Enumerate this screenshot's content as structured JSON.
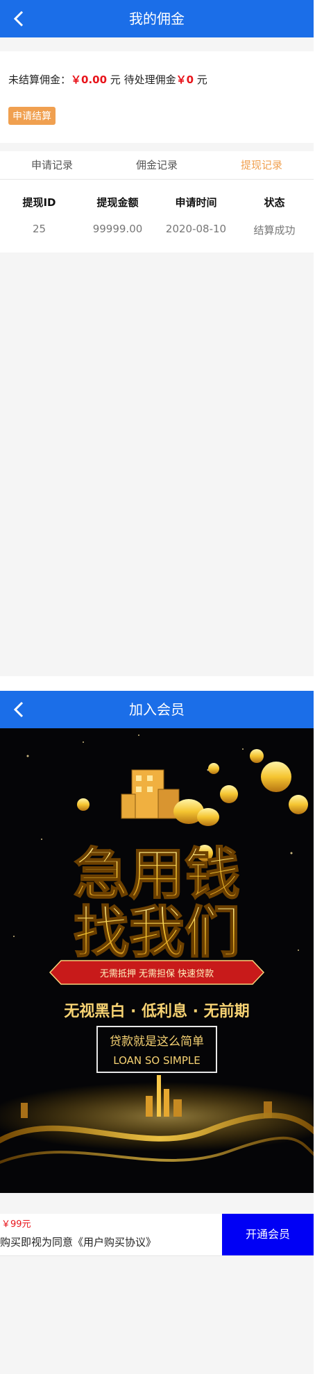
{
  "screen1": {
    "header": {
      "title": "我的佣金"
    },
    "summary": {
      "unsettled_label": "未结算佣金：",
      "unsettled_value": "￥0.00",
      "unit1": " 元 ",
      "pending_label": "待处理佣金",
      "pending_value": "￥0",
      "unit2": " 元"
    },
    "apply_button": "申请结算",
    "tabs": [
      "申请记录",
      "佣金记录",
      "提现记录"
    ],
    "active_tab": 2,
    "table": {
      "headers": [
        "提现ID",
        "提现金额",
        "申请时间",
        "状态"
      ],
      "rows": [
        [
          "25",
          "99999.00",
          "2020-08-10",
          "结算成功"
        ]
      ]
    }
  },
  "screen2": {
    "header": {
      "title": "加入会员"
    },
    "poster": {
      "headline1": "急用钱",
      "headline2": "找我们",
      "ribbon": "无需抵押 无需担保 快速贷款",
      "slogan": "无视黑白 · 低利息 · 无前期",
      "box_line1": "贷款就是这么简单",
      "box_line2": "LOAN SO SIMPLE"
    },
    "price": "￥99元",
    "agreement": "购买即视为同意《用户购买协议》",
    "open_button": "开通会员"
  },
  "colors": {
    "brand": "#1b6ee8",
    "accent": "#f0a050",
    "price": "#e8141b",
    "button": "#0000f5"
  }
}
